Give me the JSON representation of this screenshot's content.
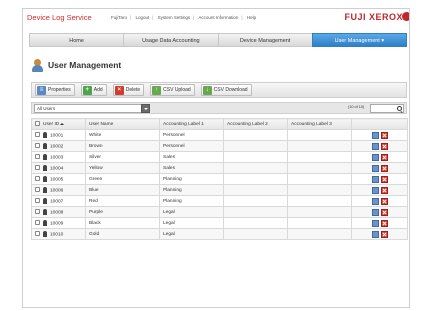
{
  "header": {
    "brand": "Device Log Service",
    "links": [
      "FujiTaro",
      "Logout",
      "System Settings",
      "Account Information",
      "Help"
    ],
    "vendor": "FUJI XEROX"
  },
  "tabs": [
    {
      "label": "Home",
      "active": false
    },
    {
      "label": "Usage Data Accounting",
      "active": false
    },
    {
      "label": "Device Management",
      "active": false
    },
    {
      "label": "User Management ▾",
      "active": true
    }
  ],
  "page": {
    "title": "User Management"
  },
  "toolbar": {
    "properties": "Properties",
    "add": "Add",
    "delete": "Delete",
    "csv_upload": "CSV Upload",
    "csv_download": "CSV Download"
  },
  "filter": {
    "selected": "All Users",
    "count": "(10 of 10)"
  },
  "table": {
    "columns": [
      "User ID",
      "User Name",
      "Accounting Label 1",
      "Accounting Label 2",
      "Accounting Label 3"
    ],
    "rows": [
      {
        "id": "10001",
        "name": "White",
        "label1": "Personnel",
        "label2": "",
        "label3": ""
      },
      {
        "id": "10002",
        "name": "Brown",
        "label1": "Personnel",
        "label2": "",
        "label3": ""
      },
      {
        "id": "10003",
        "name": "Silver",
        "label1": "Sales",
        "label2": "",
        "label3": ""
      },
      {
        "id": "10004",
        "name": "Yellow",
        "label1": "Sales",
        "label2": "",
        "label3": ""
      },
      {
        "id": "10005",
        "name": "Green",
        "label1": "Planning",
        "label2": "",
        "label3": ""
      },
      {
        "id": "10006",
        "name": "Blue",
        "label1": "Planning",
        "label2": "",
        "label3": ""
      },
      {
        "id": "10007",
        "name": "Red",
        "label1": "Planning",
        "label2": "",
        "label3": ""
      },
      {
        "id": "10008",
        "name": "Purple",
        "label1": "Legal",
        "label2": "",
        "label3": ""
      },
      {
        "id": "10009",
        "name": "Black",
        "label1": "Legal",
        "label2": "",
        "label3": ""
      },
      {
        "id": "10010",
        "name": "Gold",
        "label1": "Legal",
        "label2": "",
        "label3": ""
      }
    ]
  },
  "colors": {
    "brand": "#d32a2a",
    "active_tab": "#2f7fc8",
    "delete": "#d9332a"
  }
}
